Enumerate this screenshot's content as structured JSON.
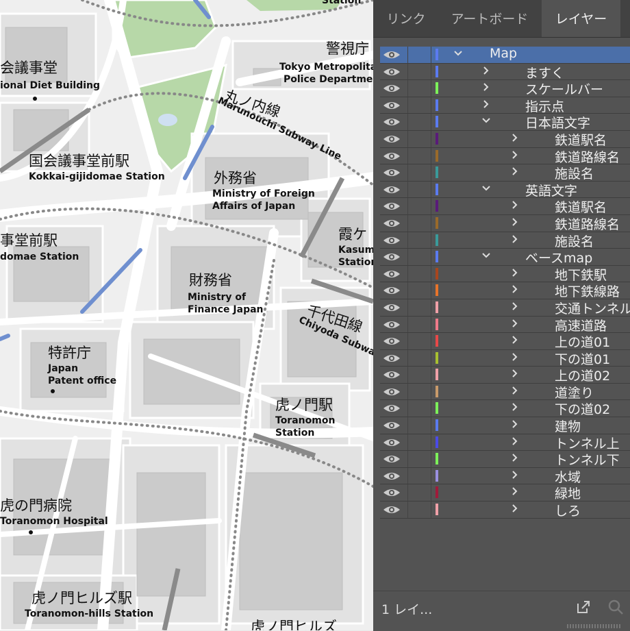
{
  "map": {
    "labels": {
      "diet_jp": "会議事堂",
      "diet_en": "ional Diet Building",
      "police_jp": "警視庁",
      "police_en1": "Tokyo Metropolita",
      "police_en2": "Police Departmen",
      "marunouchi_jp": "丸ノ内線",
      "marunouchi_en": "Marunouchi Subway Line",
      "kokkai_station_jp": "国会議事堂前駅",
      "kokkai_station_en": "Kokkai-gijidomae Station",
      "gaimusho_jp": "外務省",
      "gaimusho_en1": "Ministry of Foreign",
      "gaimusho_en2": "Affairs of Japan",
      "jidomae_jp": "事堂前駅",
      "jidomae_en": "domae Station",
      "kasumi_jp": "霞ケ",
      "kasumi_en1": "Kasum",
      "kasumi_en2": "Station",
      "zaimusho_jp": "財務省",
      "zaimusho_en1": "Ministry of",
      "zaimusho_en2": "Finance Japan",
      "chiyoda_jp": "千代田線",
      "chiyoda_en": "Chiyoda Subwa",
      "tokkyo_jp": "特許庁",
      "tokkyo_en1": "Japan",
      "tokkyo_en2": "Patent office",
      "toranomon_station_jp": "虎ノ門駅",
      "toranomon_station_en1": "Toranomon",
      "toranomon_station_en2": "Station",
      "hospital_jp": "虎の門病院",
      "hospital_en": "Toranomon Hospital",
      "hills_station_jp": "虎ノ門ヒルズ駅",
      "hills_station_en": "Toranomon-hills Station",
      "hills_bottom_jp": "虎ノ門ヒルズ",
      "station_top": "Station"
    }
  },
  "panel": {
    "tabs": [
      "リンク",
      "アートボード",
      "レイヤー"
    ],
    "active_tab": 2,
    "footer_text": "1 レイ...",
    "footer_export_icon": "export-icon",
    "footer_search_icon": "search-icon",
    "layers": [
      {
        "name": "Map",
        "color": "#5b7bf0",
        "level": 0,
        "expanded": true,
        "selected": true
      },
      {
        "name": "ますく",
        "color": "#5b7bf0",
        "level": 1,
        "expanded": false
      },
      {
        "name": "スケールバー",
        "color": "#7cf05a",
        "level": 1,
        "expanded": false
      },
      {
        "name": "指示点",
        "color": "#5b7bf0",
        "level": 1,
        "expanded": false
      },
      {
        "name": "日本語文字",
        "color": "#5b7bf0",
        "level": 1,
        "expanded": true
      },
      {
        "name": "鉄道駅名",
        "color": "#5a1a7a",
        "level": 2,
        "expanded": false
      },
      {
        "name": "鉄道路線名",
        "color": "#9a6a2a",
        "level": 2,
        "expanded": false
      },
      {
        "name": "施設名",
        "color": "#3a9a9a",
        "level": 2,
        "expanded": false
      },
      {
        "name": "英語文字",
        "color": "#5b7bf0",
        "level": 1,
        "expanded": true
      },
      {
        "name": "鉄道駅名",
        "color": "#5a1a7a",
        "level": 2,
        "expanded": false
      },
      {
        "name": "鉄道路線名",
        "color": "#9a6a2a",
        "level": 2,
        "expanded": false
      },
      {
        "name": "施設名",
        "color": "#3a9a9a",
        "level": 2,
        "expanded": false
      },
      {
        "name": "ベースmap",
        "color": "#5b7bf0",
        "level": 1,
        "expanded": true
      },
      {
        "name": "地下鉄駅",
        "color": "#a9461e",
        "level": 2,
        "expanded": false
      },
      {
        "name": "地下鉄線路",
        "color": "#e8742a",
        "level": 2,
        "expanded": false
      },
      {
        "name": "交通トンネル",
        "color": "#f0a0a8",
        "level": 2,
        "expanded": false
      },
      {
        "name": "高速道路",
        "color": "#f07a8a",
        "level": 2,
        "expanded": false
      },
      {
        "name": "上の道01",
        "color": "#e84848",
        "level": 2,
        "expanded": false
      },
      {
        "name": "下の道01",
        "color": "#a8c030",
        "level": 2,
        "expanded": false
      },
      {
        "name": "上の道02",
        "color": "#f0a0a8",
        "level": 2,
        "expanded": false
      },
      {
        "name": "道塗り",
        "color": "#c89a6a",
        "level": 2,
        "expanded": false
      },
      {
        "name": "下の道02",
        "color": "#7cf05a",
        "level": 2,
        "expanded": false
      },
      {
        "name": "建物",
        "color": "#5b7bf0",
        "level": 2,
        "expanded": false
      },
      {
        "name": "トンネル上",
        "color": "#4a4ae8",
        "level": 2,
        "expanded": false
      },
      {
        "name": "トンネル下",
        "color": "#7cf05a",
        "level": 2,
        "expanded": false
      },
      {
        "name": "水域",
        "color": "#9a90e0",
        "level": 2,
        "expanded": false
      },
      {
        "name": "緑地",
        "color": "#a01a3a",
        "level": 2,
        "expanded": false
      },
      {
        "name": "しろ",
        "color": "#f0a0a8",
        "level": 2,
        "expanded": false
      }
    ]
  }
}
